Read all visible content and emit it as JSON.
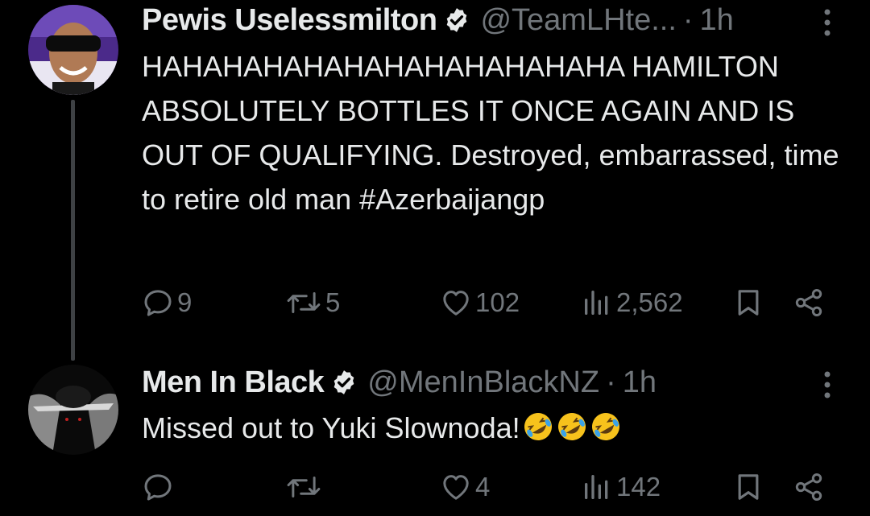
{
  "tweets": [
    {
      "author": {
        "name": "Pewis Uselessmilton",
        "handle": "@TeamLHte...",
        "verified": true
      },
      "separator": "·",
      "time": "1h",
      "text": "HAHAHAHAHAHAHAHAHAHAHAHA HAMILTON ABSOLUTELY BOTTLES IT ONCE AGAIN AND IS OUT OF QUALIFYING. Destroyed, embarrassed, time to retire old man #Azerbaijangp",
      "stats": {
        "replies": "9",
        "retweets": "5",
        "likes": "102",
        "views": "2,562"
      }
    },
    {
      "author": {
        "name": "Men In Black",
        "handle": "@MenInBlackNZ",
        "verified": true
      },
      "separator": "·",
      "time": "1h",
      "text": "Missed out to Yuki Slownoda!",
      "emojis": [
        "rolling-on-floor-laughing",
        "rolling-on-floor-laughing",
        "rolling-on-floor-laughing"
      ],
      "stats": {
        "replies": "",
        "retweets": "",
        "likes": "4",
        "views": "142"
      }
    }
  ],
  "colors": {
    "background": "#000000",
    "text_primary": "#e7e9ea",
    "text_secondary": "#71767b",
    "thread_line": "#3e4144"
  },
  "icons": [
    "verified-badge-icon",
    "more-icon",
    "reply-icon",
    "retweet-icon",
    "like-icon",
    "views-icon",
    "bookmark-icon",
    "share-icon"
  ]
}
